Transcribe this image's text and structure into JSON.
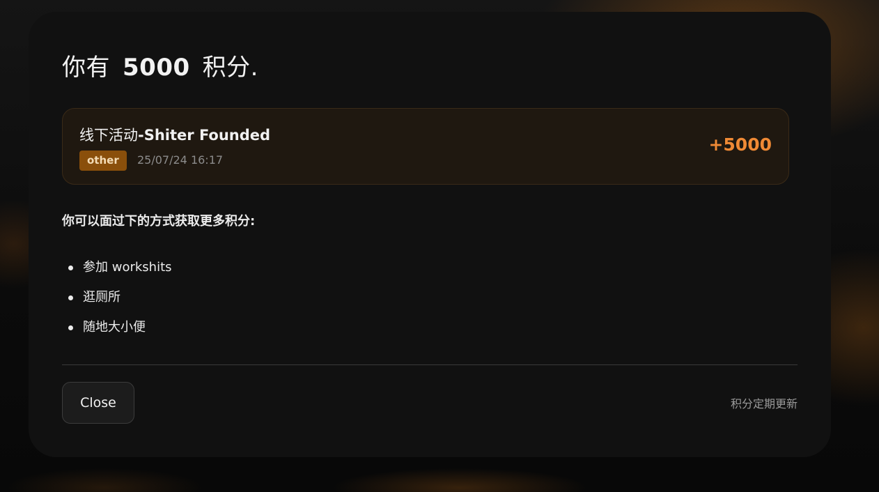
{
  "modal": {
    "title_prefix": "你有",
    "points_total": "5000",
    "title_suffix": "积分.",
    "record": {
      "title_prefix": "线下活动",
      "title_sep": "-",
      "title_name": "Shiter Founded",
      "tag": "other",
      "timestamp": "25/07/24 16:17",
      "points": "+5000",
      "tag_color": "#8a4f0b",
      "points_color": "#f08a35"
    },
    "hint": "你可以面过下的方式获取更多积分:",
    "ways": [
      "参加 workshits",
      "逛厕所",
      "随地大小便"
    ],
    "close_label": "Close",
    "note": "积分定期更新"
  }
}
